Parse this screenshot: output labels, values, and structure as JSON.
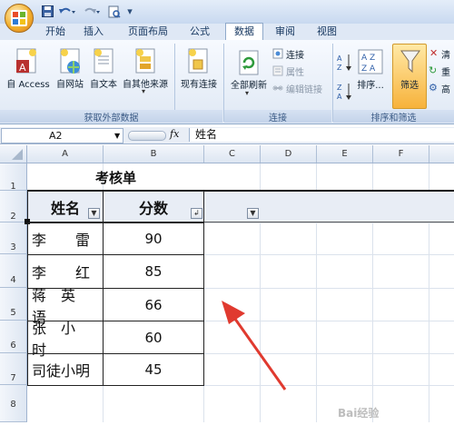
{
  "quick_access": {
    "save": "save-icon",
    "undo": "undo-icon",
    "redo": "redo-icon",
    "print": "print-preview-icon"
  },
  "tabs": [
    "开始",
    "插入",
    "页面布局",
    "公式",
    "数据",
    "审阅",
    "视图"
  ],
  "active_tab": "数据",
  "ribbon": {
    "get_external": {
      "group_label": "获取外部数据",
      "buttons": [
        "自 Access",
        "自网站",
        "自文本",
        "自其他来源",
        "现有连接"
      ]
    },
    "connections": {
      "group_label": "连接",
      "refresh_all": "全部刷新",
      "small": [
        "连接",
        "属性",
        "编辑链接"
      ]
    },
    "sort_filter": {
      "group_label": "排序和筛选",
      "sort": "排序...",
      "filter": "筛选",
      "small": [
        "清",
        "重",
        "高"
      ]
    }
  },
  "formula_bar": {
    "name_box": "A2",
    "fx": "fx",
    "formula": "姓名"
  },
  "columns": [
    "A",
    "B",
    "C",
    "D",
    "E",
    "F"
  ],
  "rows": [
    "1",
    "2",
    "3",
    "4",
    "5",
    "6",
    "7",
    "8"
  ],
  "sheet": {
    "title": "考核单",
    "headers": [
      "姓名",
      "分数"
    ],
    "names": [
      "李　　雷",
      "李　　红",
      "蒋　英　语",
      "张　小　时",
      "司徒小明"
    ],
    "scores": [
      "90",
      "85",
      "66",
      "60",
      "45"
    ]
  },
  "accent": {
    "filter_active": "#f7b23b",
    "arrow": "#e03a2f"
  },
  "watermark": "Bai经验"
}
